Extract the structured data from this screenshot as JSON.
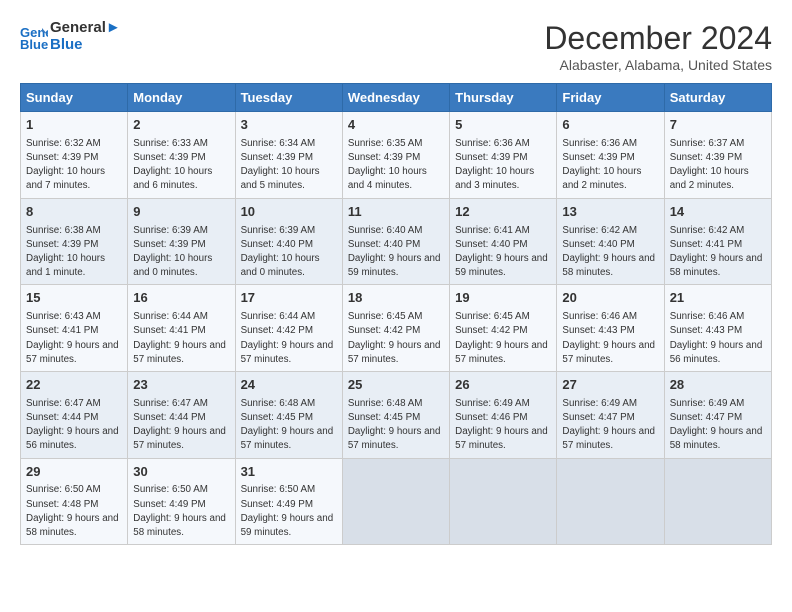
{
  "header": {
    "logo_line1": "General",
    "logo_line2": "Blue",
    "month": "December 2024",
    "location": "Alabaster, Alabama, United States"
  },
  "weekdays": [
    "Sunday",
    "Monday",
    "Tuesday",
    "Wednesday",
    "Thursday",
    "Friday",
    "Saturday"
  ],
  "weeks": [
    [
      {
        "day": "1",
        "info": "Sunrise: 6:32 AM\nSunset: 4:39 PM\nDaylight: 10 hours and 7 minutes."
      },
      {
        "day": "2",
        "info": "Sunrise: 6:33 AM\nSunset: 4:39 PM\nDaylight: 10 hours and 6 minutes."
      },
      {
        "day": "3",
        "info": "Sunrise: 6:34 AM\nSunset: 4:39 PM\nDaylight: 10 hours and 5 minutes."
      },
      {
        "day": "4",
        "info": "Sunrise: 6:35 AM\nSunset: 4:39 PM\nDaylight: 10 hours and 4 minutes."
      },
      {
        "day": "5",
        "info": "Sunrise: 6:36 AM\nSunset: 4:39 PM\nDaylight: 10 hours and 3 minutes."
      },
      {
        "day": "6",
        "info": "Sunrise: 6:36 AM\nSunset: 4:39 PM\nDaylight: 10 hours and 2 minutes."
      },
      {
        "day": "7",
        "info": "Sunrise: 6:37 AM\nSunset: 4:39 PM\nDaylight: 10 hours and 2 minutes."
      }
    ],
    [
      {
        "day": "8",
        "info": "Sunrise: 6:38 AM\nSunset: 4:39 PM\nDaylight: 10 hours and 1 minute."
      },
      {
        "day": "9",
        "info": "Sunrise: 6:39 AM\nSunset: 4:39 PM\nDaylight: 10 hours and 0 minutes."
      },
      {
        "day": "10",
        "info": "Sunrise: 6:39 AM\nSunset: 4:40 PM\nDaylight: 10 hours and 0 minutes."
      },
      {
        "day": "11",
        "info": "Sunrise: 6:40 AM\nSunset: 4:40 PM\nDaylight: 9 hours and 59 minutes."
      },
      {
        "day": "12",
        "info": "Sunrise: 6:41 AM\nSunset: 4:40 PM\nDaylight: 9 hours and 59 minutes."
      },
      {
        "day": "13",
        "info": "Sunrise: 6:42 AM\nSunset: 4:40 PM\nDaylight: 9 hours and 58 minutes."
      },
      {
        "day": "14",
        "info": "Sunrise: 6:42 AM\nSunset: 4:41 PM\nDaylight: 9 hours and 58 minutes."
      }
    ],
    [
      {
        "day": "15",
        "info": "Sunrise: 6:43 AM\nSunset: 4:41 PM\nDaylight: 9 hours and 57 minutes."
      },
      {
        "day": "16",
        "info": "Sunrise: 6:44 AM\nSunset: 4:41 PM\nDaylight: 9 hours and 57 minutes."
      },
      {
        "day": "17",
        "info": "Sunrise: 6:44 AM\nSunset: 4:42 PM\nDaylight: 9 hours and 57 minutes."
      },
      {
        "day": "18",
        "info": "Sunrise: 6:45 AM\nSunset: 4:42 PM\nDaylight: 9 hours and 57 minutes."
      },
      {
        "day": "19",
        "info": "Sunrise: 6:45 AM\nSunset: 4:42 PM\nDaylight: 9 hours and 57 minutes."
      },
      {
        "day": "20",
        "info": "Sunrise: 6:46 AM\nSunset: 4:43 PM\nDaylight: 9 hours and 57 minutes."
      },
      {
        "day": "21",
        "info": "Sunrise: 6:46 AM\nSunset: 4:43 PM\nDaylight: 9 hours and 56 minutes."
      }
    ],
    [
      {
        "day": "22",
        "info": "Sunrise: 6:47 AM\nSunset: 4:44 PM\nDaylight: 9 hours and 56 minutes."
      },
      {
        "day": "23",
        "info": "Sunrise: 6:47 AM\nSunset: 4:44 PM\nDaylight: 9 hours and 57 minutes."
      },
      {
        "day": "24",
        "info": "Sunrise: 6:48 AM\nSunset: 4:45 PM\nDaylight: 9 hours and 57 minutes."
      },
      {
        "day": "25",
        "info": "Sunrise: 6:48 AM\nSunset: 4:45 PM\nDaylight: 9 hours and 57 minutes."
      },
      {
        "day": "26",
        "info": "Sunrise: 6:49 AM\nSunset: 4:46 PM\nDaylight: 9 hours and 57 minutes."
      },
      {
        "day": "27",
        "info": "Sunrise: 6:49 AM\nSunset: 4:47 PM\nDaylight: 9 hours and 57 minutes."
      },
      {
        "day": "28",
        "info": "Sunrise: 6:49 AM\nSunset: 4:47 PM\nDaylight: 9 hours and 58 minutes."
      }
    ],
    [
      {
        "day": "29",
        "info": "Sunrise: 6:50 AM\nSunset: 4:48 PM\nDaylight: 9 hours and 58 minutes."
      },
      {
        "day": "30",
        "info": "Sunrise: 6:50 AM\nSunset: 4:49 PM\nDaylight: 9 hours and 58 minutes."
      },
      {
        "day": "31",
        "info": "Sunrise: 6:50 AM\nSunset: 4:49 PM\nDaylight: 9 hours and 59 minutes."
      },
      null,
      null,
      null,
      null
    ]
  ]
}
